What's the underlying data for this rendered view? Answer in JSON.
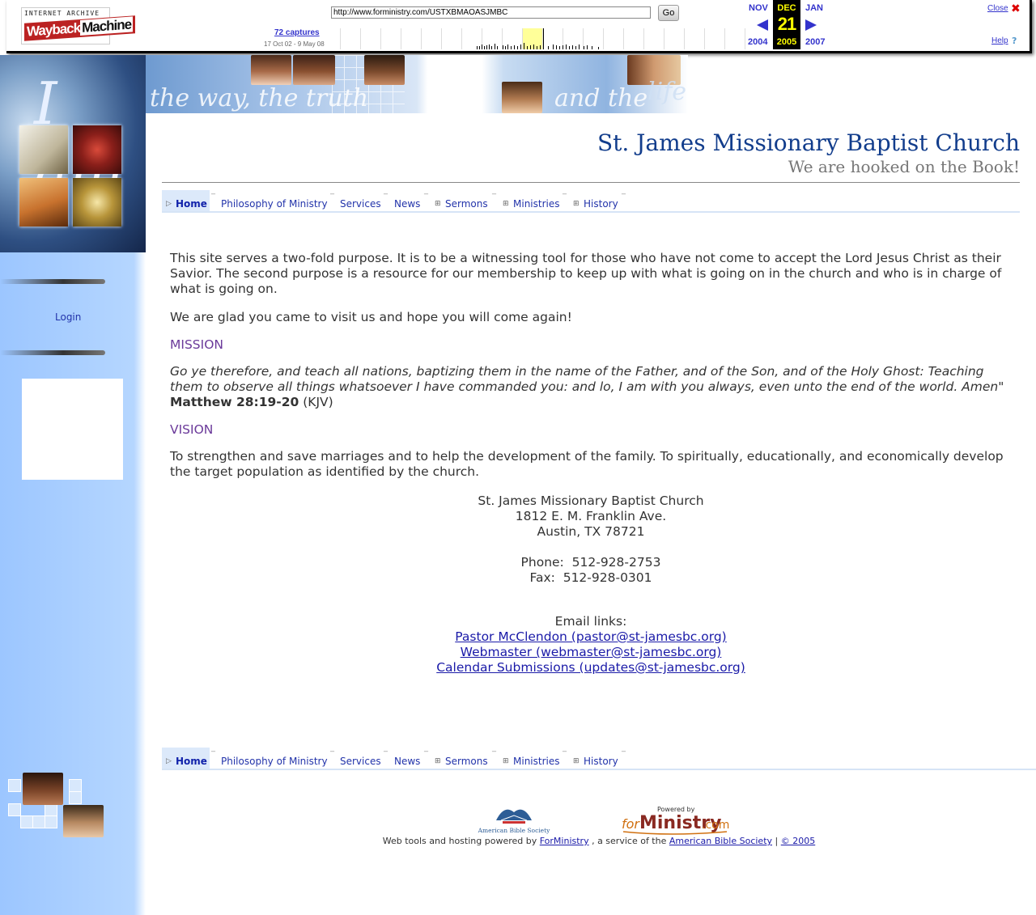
{
  "wayback": {
    "logo_top": "INTERNET ARCHIVE",
    "logo_wayback": "Wayback",
    "logo_machine": "Machine",
    "url": "http://www.forministry.com/USTXBMAOASJMBC",
    "go_label": "Go",
    "captures_label": "72 captures",
    "date_range": "17 Oct 02 - 9 May 08",
    "prev_month": "NOV",
    "current_month": "DEC",
    "next_month": "JAN",
    "current_day": "21",
    "prev_year": "2004",
    "current_year": "2005",
    "next_year": "2007",
    "close_label": "Close",
    "help_label": "Help",
    "help_glyph": "?",
    "close_glyph": "✖"
  },
  "banner": {
    "script_left": "the way, the truth",
    "script_right": "and the",
    "script_life": "life",
    "glyph": "I am"
  },
  "header": {
    "church_name": "St. James Missionary Baptist Church",
    "tagline": "We are hooked on the Book!"
  },
  "sidebar": {
    "login_label": "Login"
  },
  "nav": {
    "items": [
      {
        "label": "Home"
      },
      {
        "label": "Philosophy of Ministry"
      },
      {
        "label": "Services"
      },
      {
        "label": "News"
      },
      {
        "label": "Sermons"
      },
      {
        "label": "Ministries"
      },
      {
        "label": "History"
      }
    ]
  },
  "content": {
    "intro": "This site serves a two-fold purpose. It is to be a witnessing tool for those who have not come to accept the Lord Jesus Christ as their Savior. The second purpose is a resource for our membership to keep up with what is going on in the church and who is in charge of what is going on.",
    "welcome": "We are glad you came to visit us and hope you will come again!",
    "mission_heading": "MISSION",
    "mission_quote": "Go ye therefore, and teach all nations, baptizing them in the name of the Father, and of the Son, and of the Holy Ghost: Teaching them to observe all things whatsoever I have commanded you: and lo, I am with you always, even unto the end of the world. Amen",
    "mission_quote_close": "\"",
    "mission_ref": "Matthew 28:19-20",
    "mission_version": "(KJV)",
    "vision_heading": "VISION",
    "vision_text": "To strengthen and save marriages and to help the development of the family. To spiritually, educationally, and economically develop the target population as identified by the church."
  },
  "contact": {
    "name": "St. James Missionary Baptist Church",
    "street": "1812 E. M. Franklin Ave.",
    "city": "Austin, TX 78721",
    "phone": "Phone:  512-928-2753",
    "fax": "Fax:  512-928-0301",
    "email_heading": "Email links:",
    "links": [
      {
        "label": "Pastor McClendon (pastor@st-jamesbc.org)"
      },
      {
        "label": "Webmaster (webmaster@st-jamesbc.org)"
      },
      {
        "label": "Calendar Submissions (updates@st-jamesbc.org)"
      }
    ]
  },
  "footer": {
    "abs_logo_text": "American Bible Society",
    "fm_powered": "Powered by",
    "fm_logo_for": "for",
    "fm_logo_ministry": "Ministry",
    "fm_logo_com": ".com",
    "prefix": "Web tools and hosting powered by",
    "forministry_link": "ForMinistry",
    "middle": ", a service of the",
    "abs_link": "American Bible Society",
    "divider": "|",
    "copyright_link": "© 2005"
  },
  "colors": {
    "accent_blue": "#123d8c",
    "link_blue": "#1a1aa8",
    "heading_purple": "#6b3a9a",
    "sidebar_blue": "#9cc6ff"
  }
}
